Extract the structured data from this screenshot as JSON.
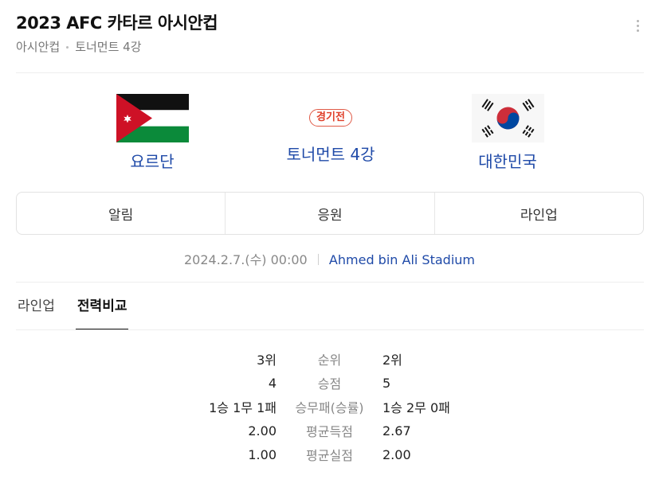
{
  "header": {
    "title": "2023 AFC 카타르 아시안컵",
    "league": "아시안컵",
    "round": "토너먼트 4강"
  },
  "match": {
    "home": {
      "name": "요르단",
      "flag": "jordan-flag"
    },
    "away": {
      "name": "대한민국",
      "flag": "korea-flag"
    },
    "status_badge": "경기전",
    "round": "토너먼트 4강",
    "datetime": "2024.2.7.(수) 00:00",
    "stadium": "Ahmed bin Ali Stadium"
  },
  "main_tabs": [
    "알림",
    "응원",
    "라인업"
  ],
  "sub_tabs": [
    "라인업",
    "전력비교"
  ],
  "comparison": [
    {
      "home": "3위",
      "label": "순위",
      "away": "2위"
    },
    {
      "home": "4",
      "label": "승점",
      "away": "5"
    },
    {
      "home": "1승 1무 1패",
      "label": "승무패(승률)",
      "away": "1승 2무 0패"
    },
    {
      "home": "2.00",
      "label": "평균득점",
      "away": "2.67"
    },
    {
      "home": "1.00",
      "label": "평균실점",
      "away": "2.00"
    }
  ],
  "colors": {
    "link_blue": "#1f4aa8",
    "badge_red": "#e0402b"
  }
}
